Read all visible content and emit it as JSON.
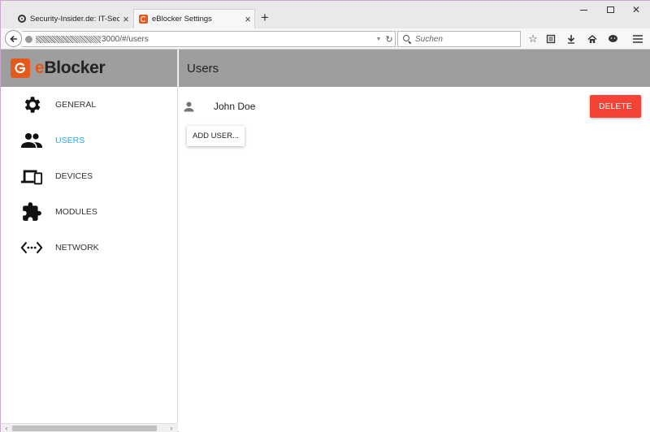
{
  "browser": {
    "tabs": [
      {
        "title": "Security-Insider.de: IT-Sec...",
        "favicon": "globe-icon",
        "active": false
      },
      {
        "title": "eBlocker Settings",
        "favicon": "eblocker-icon",
        "active": true
      }
    ],
    "url": "3000/#/users",
    "search_placeholder": "Suchen"
  },
  "app": {
    "brand_prefix": "e",
    "brand_suffix": "Blocker",
    "brand_color": "#e55a1c",
    "header_color": "#9e9e9e",
    "active_color": "#2aa7de"
  },
  "sidebar": {
    "items": [
      {
        "label": "GENERAL",
        "icon": "gear-icon",
        "active": false
      },
      {
        "label": "USERS",
        "icon": "people-icon",
        "active": true
      },
      {
        "label": "DEVICES",
        "icon": "devices-icon",
        "active": false
      },
      {
        "label": "MODULES",
        "icon": "puzzle-icon",
        "active": false
      },
      {
        "label": "NETWORK",
        "icon": "network-icon",
        "active": false
      }
    ]
  },
  "main": {
    "title": "Users",
    "users": [
      {
        "name": "John Doe"
      }
    ],
    "delete_label": "DELETE",
    "delete_color": "#f44336",
    "add_user_label": "ADD USER..."
  }
}
